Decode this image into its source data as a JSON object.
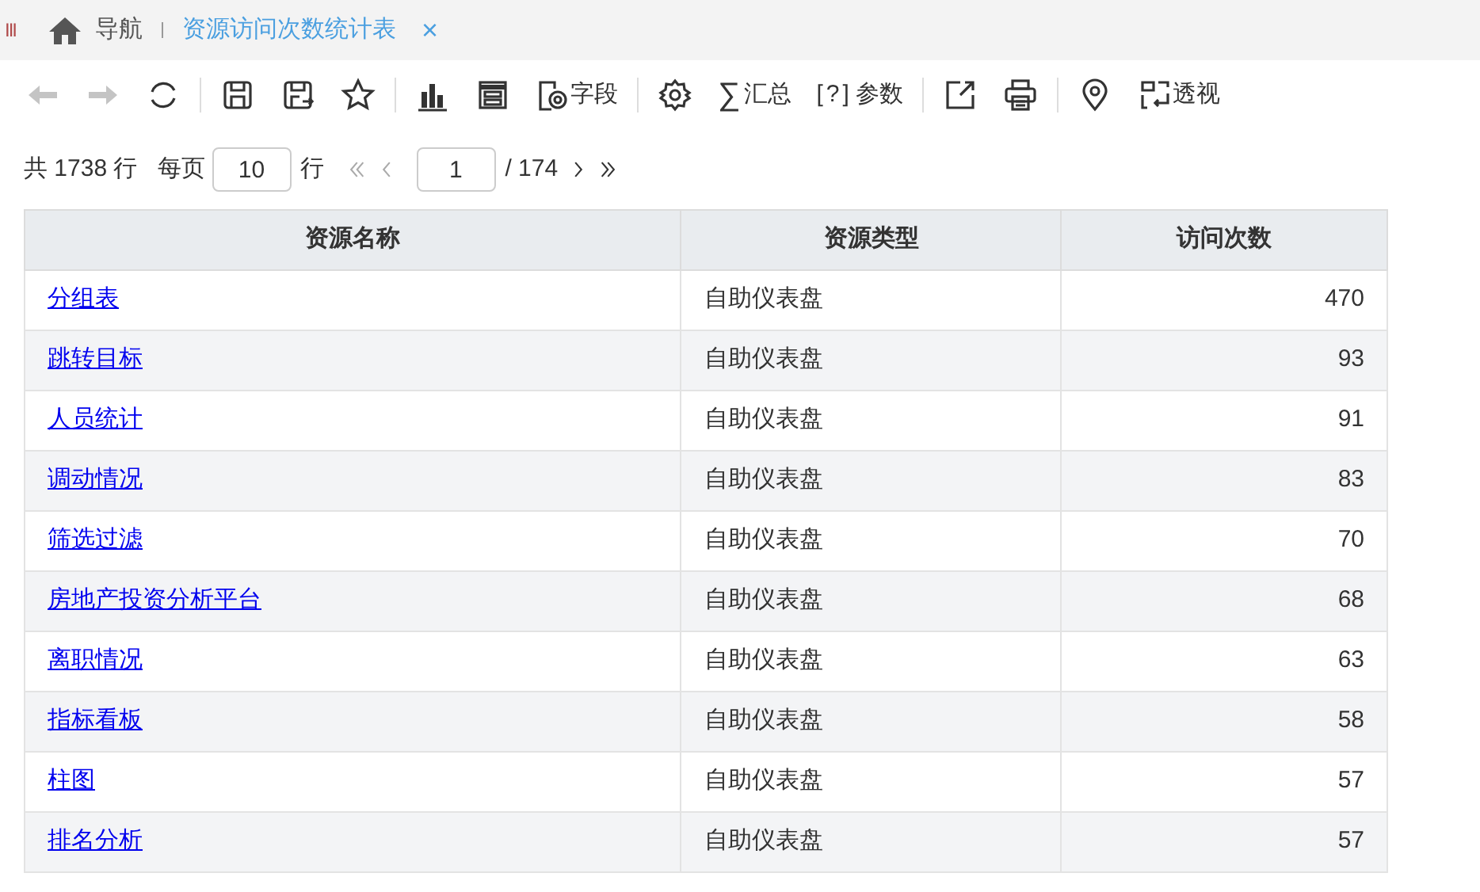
{
  "tab_bar": {
    "menu_glyph": "III",
    "home_label": "导航",
    "tabs": [
      {
        "label": "资源访问次数统计表",
        "selected": true,
        "close": "×"
      }
    ]
  },
  "toolbar": {
    "groups": [
      {
        "buttons": [
          {
            "disabled": true
          },
          {
            "disabled": true
          },
          {
            "disabled": false
          }
        ]
      },
      {
        "buttons": [
          {
            "disabled": false
          },
          {
            "disabled": false
          },
          {
            "disabled": false
          }
        ]
      },
      {
        "buttons": [
          {
            "disabled": false
          },
          {
            "disabled": false
          },
          {
            "disabled": false,
            "label": "字段"
          }
        ]
      },
      {
        "buttons": [
          {
            "disabled": false
          },
          {
            "disabled": false,
            "glyph": "∑",
            "label": "汇总"
          },
          {
            "disabled": false,
            "glyph": "[?]",
            "label": "参数"
          }
        ]
      },
      {
        "buttons": [
          {
            "disabled": false
          },
          {
            "disabled": false
          }
        ]
      },
      {
        "buttons": [
          {
            "disabled": false
          },
          {
            "disabled": false,
            "label": "透视"
          }
        ]
      }
    ]
  },
  "pagination": {
    "total_text": "共 1738 行",
    "per_page_label": "每页",
    "per_page": "10",
    "rows_unit": "行",
    "page": "1",
    "page_count": "/ 174",
    "first_disabled": true,
    "prev_disabled": true
  },
  "table": {
    "columns": [
      "资源名称",
      "资源类型",
      "访问次数"
    ],
    "rows": [
      [
        "分组表",
        "自助仪表盘",
        "470"
      ],
      [
        "跳转目标",
        "自助仪表盘",
        "93"
      ],
      [
        "人员统计",
        "自助仪表盘",
        "91"
      ],
      [
        "调动情况",
        "自助仪表盘",
        "83"
      ],
      [
        "筛选过滤",
        "自助仪表盘",
        "70"
      ],
      [
        "房地产投资分析平台",
        "自助仪表盘",
        "68"
      ],
      [
        "离职情况",
        "自助仪表盘",
        "63"
      ],
      [
        "指标看板",
        "自助仪表盘",
        "58"
      ],
      [
        "柱图",
        "自助仪表盘",
        "57"
      ],
      [
        "排名分析",
        "自助仪表盘",
        "57"
      ]
    ]
  }
}
